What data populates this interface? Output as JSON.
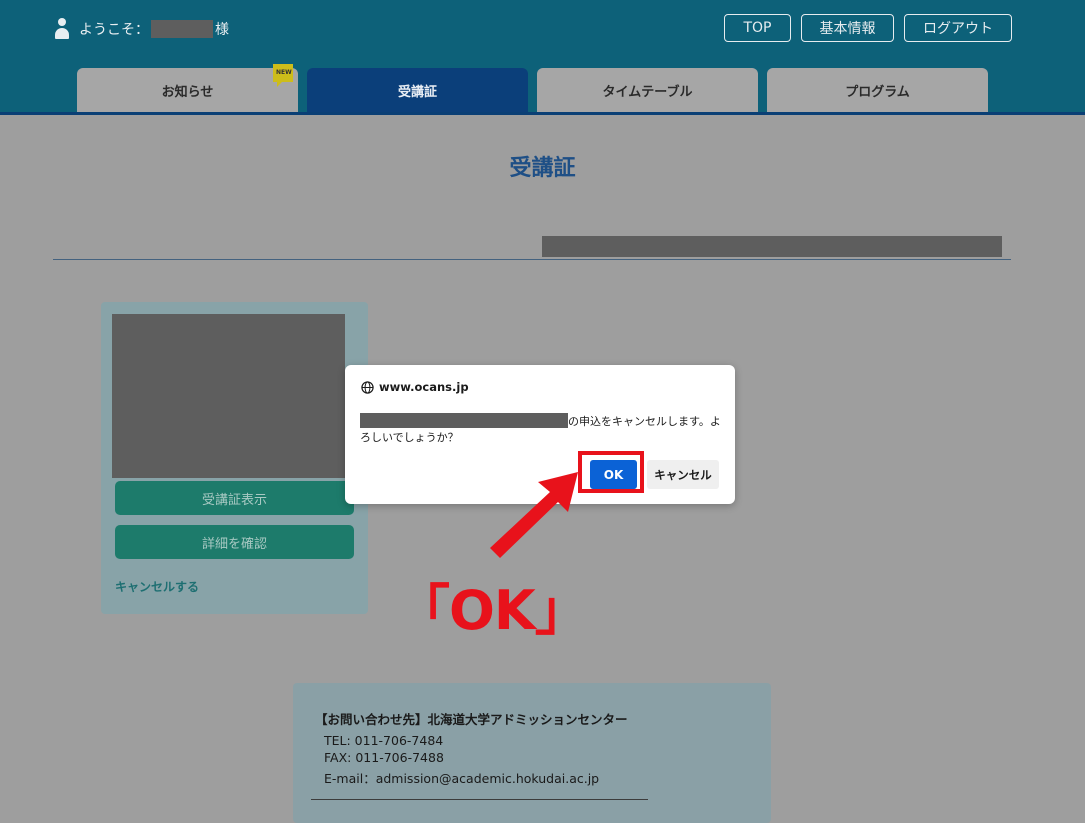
{
  "header": {
    "welcome_prefix": "ようこそ：",
    "welcome_suffix": "様",
    "nav_buttons": [
      "TOP",
      "基本情報",
      "ログアウト"
    ],
    "tabs": [
      {
        "label": "お知らせ",
        "badge": "NEW"
      },
      {
        "label": "受講証"
      },
      {
        "label": "タイムテーブル"
      },
      {
        "label": "プログラム"
      }
    ]
  },
  "main": {
    "title": "受講証",
    "card": {
      "buttons": [
        "受講証表示",
        "詳細を確認"
      ],
      "cancel_link": "キャンセルする"
    }
  },
  "footer": {
    "title": "【お問い合わせ先】北海道大学アドミッションセンター",
    "tel": "TEL: 011-706-7484",
    "fax": "FAX: 011-706-7488",
    "email": "E-mail：admission@academic.hokudai.ac.jp"
  },
  "dialog": {
    "host": "www.ocans.jp",
    "message": "の申込をキャンセルします。よろしいでしょうか？",
    "ok_label": "OK",
    "cancel_label": "キャンセル"
  },
  "annotation": {
    "callout": "「OK」",
    "color": "#e8121b"
  },
  "colors": {
    "header_bg": "#0d6179",
    "active_tab": "#0b3f7a",
    "card_button": "#1d7b6b",
    "dialog_ok": "#0b62d6"
  }
}
